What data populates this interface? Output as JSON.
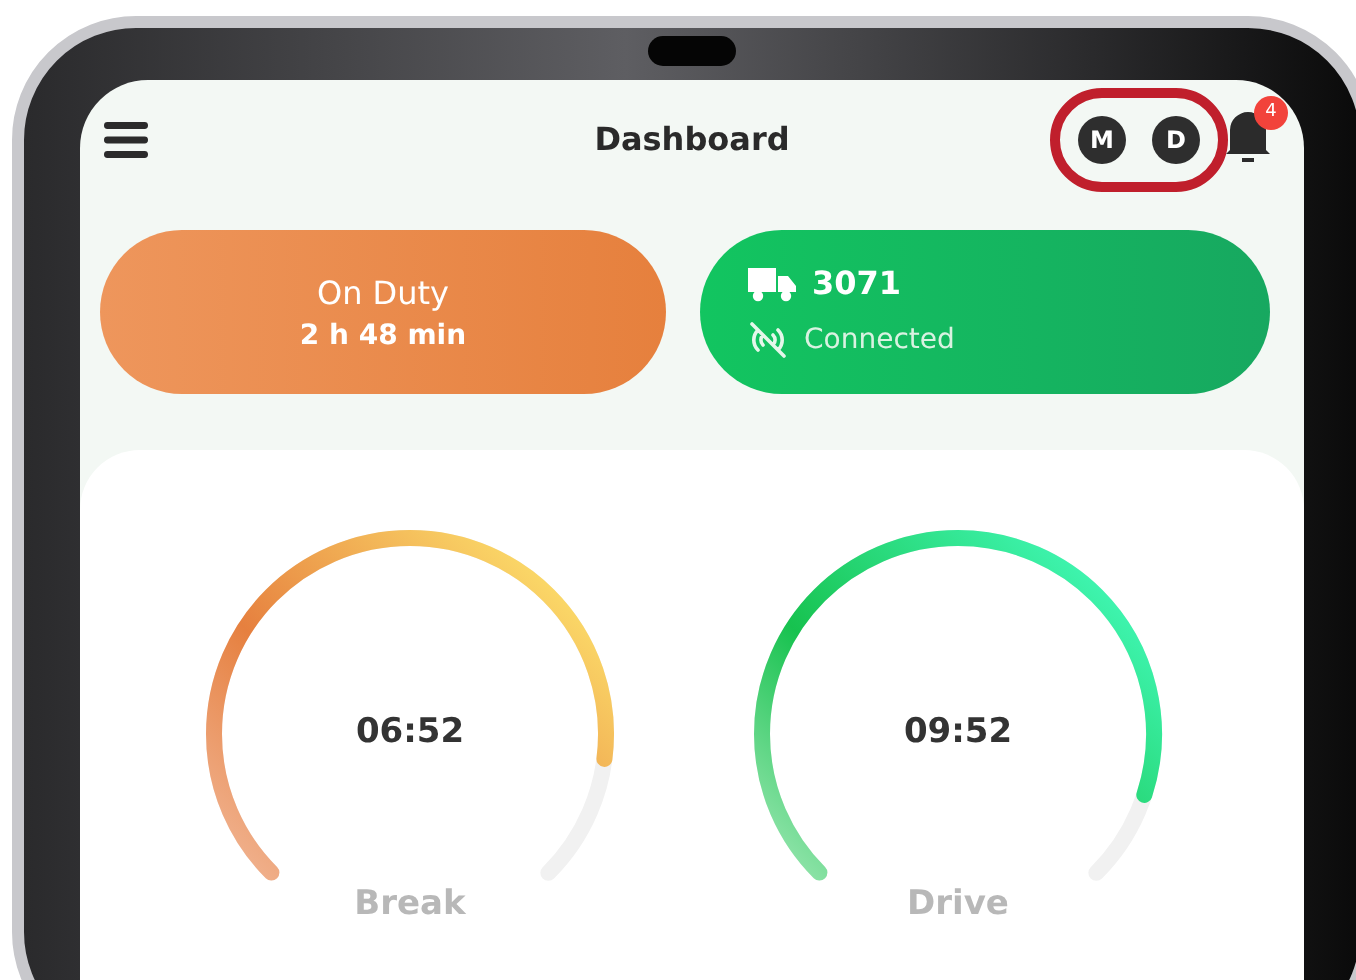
{
  "header": {
    "title": "Dashboard",
    "chips": [
      "M",
      "D"
    ],
    "notification_count": "4"
  },
  "duty_card": {
    "status": "On Duty",
    "duration": "2 h 48 min"
  },
  "vehicle_card": {
    "number": "3071",
    "connection": "Connected"
  },
  "gauges": [
    {
      "kind": "break",
      "time": "06:52",
      "label": "Break",
      "level": 0.86
    },
    {
      "kind": "drive",
      "time": "09:52",
      "label": "Drive",
      "level": 0.9
    }
  ]
}
